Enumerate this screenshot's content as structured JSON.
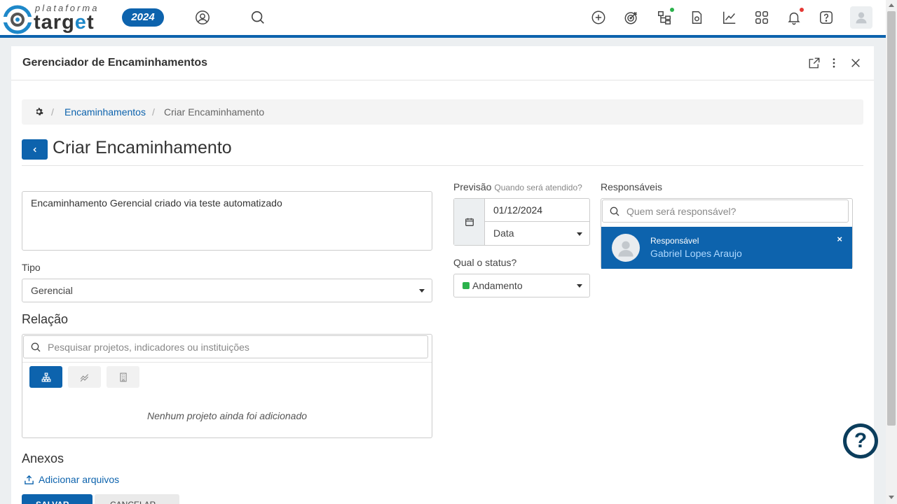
{
  "app": {
    "logo_top": "plataforma",
    "logo_main": "target",
    "year": "2024"
  },
  "topbar_icons": [
    "user-circle-icon",
    "search-icon",
    "add-circle-icon",
    "target-icon",
    "hierarchy-icon",
    "document-settings-icon",
    "line-chart-icon",
    "apps-grid-icon",
    "bell-icon",
    "help-icon",
    "user-avatar-icon"
  ],
  "panel": {
    "title": "Gerenciador de Encaminhamentos"
  },
  "breadcrumb": {
    "sep": "/",
    "link": "Encaminhamentos",
    "current": "Criar Encaminhamento"
  },
  "page": {
    "title": "Criar Encaminhamento"
  },
  "form": {
    "description": "Encaminhamento Gerencial criado via teste automatizado",
    "tipo_label": "Tipo",
    "tipo_value": "Gerencial",
    "relacao_title": "Relação",
    "relacao_search_placeholder": "Pesquisar projetos, indicadores ou instituições",
    "relacao_empty": "Nenhum projeto ainda foi adicionado",
    "anexos_title": "Anexos",
    "add_files": "Adicionar arquivos",
    "save_label": "SALVAR",
    "cancel_label": "CANCELAR",
    "previsao_label": "Previsão",
    "previsao_hint": "Quando será atendido?",
    "previsao_date": "01/12/2024",
    "previsao_type": "Data",
    "status_label": "Qual o status?",
    "status_value": "Andamento",
    "status_color": "#2bb24c",
    "responsaveis_label": "Responsáveis",
    "responsaveis_placeholder": "Quem será responsável?",
    "responsavel_role": "Responsável",
    "responsavel_name": "Gabriel Lopes Araujo",
    "remove_symbol": "×"
  },
  "help": {
    "symbol": "?"
  },
  "colors": {
    "primary": "#0d63ad",
    "status_green": "#2bb24c",
    "notification_red": "#e53935",
    "online_green": "#2bb24c"
  }
}
